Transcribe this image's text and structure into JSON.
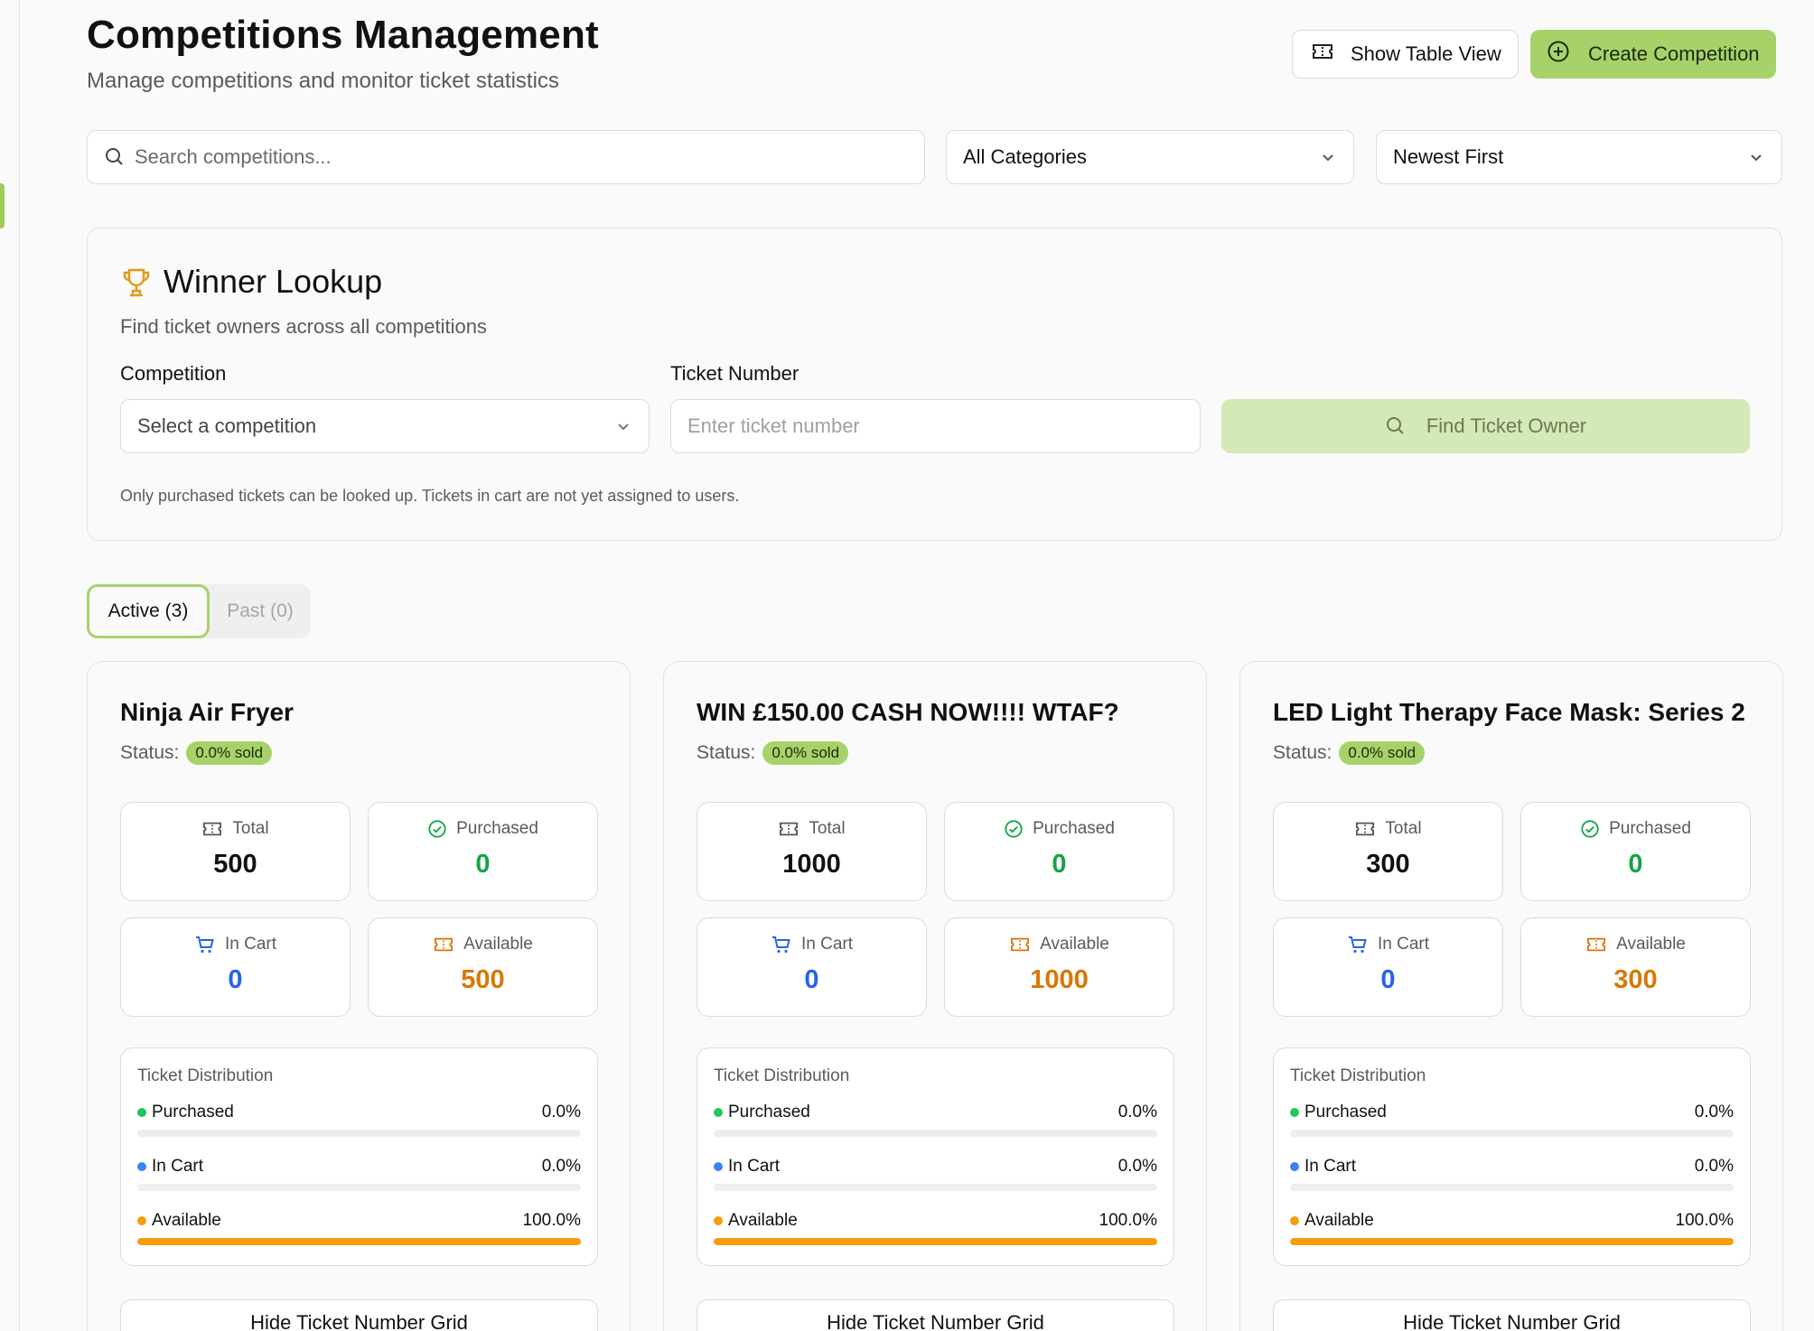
{
  "header": {
    "title": "Competitions Management",
    "subtitle": "Manage competitions and monitor ticket statistics",
    "table_view_label": "Show Table View",
    "create_label": "Create Competition"
  },
  "filters": {
    "search_placeholder": "Search competitions...",
    "category_value": "All Categories",
    "sort_value": "Newest First"
  },
  "winner_lookup": {
    "title": "Winner Lookup",
    "subtitle": "Find ticket owners across all competitions",
    "competition_label": "Competition",
    "competition_placeholder": "Select a competition",
    "ticket_label": "Ticket Number",
    "ticket_placeholder": "Enter ticket number",
    "find_label": "Find Ticket Owner",
    "note": "Only purchased tickets can be looked up. Tickets in cart are not yet assigned to users."
  },
  "tabs": [
    {
      "label": "Active (3)"
    },
    {
      "label": "Past (0)"
    }
  ],
  "labels": {
    "status": "Status:",
    "total": "Total",
    "purchased": "Purchased",
    "in_cart": "In Cart",
    "available": "Available",
    "distribution": "Ticket Distribution",
    "grid_button": "Hide Ticket Number Grid"
  },
  "colors": {
    "accent": "#a7d26a",
    "purchased": "#16a34a",
    "in_cart": "#2563eb",
    "available": "#d97706",
    "bar_available": "#f59e0b"
  },
  "competitions": [
    {
      "title": "Ninja Air Fryer",
      "status_badge": "0.0% sold",
      "total": "500",
      "purchased": "0",
      "in_cart": "0",
      "available": "500",
      "purchased_pct": "0.0%",
      "in_cart_pct": "0.0%",
      "available_pct": "100.0%",
      "purchased_fraction": 0,
      "in_cart_fraction": 0,
      "available_fraction": 1
    },
    {
      "title": "WIN £150.00 CASH NOW!!!! WTAF?",
      "status_badge": "0.0% sold",
      "total": "1000",
      "purchased": "0",
      "in_cart": "0",
      "available": "1000",
      "purchased_pct": "0.0%",
      "in_cart_pct": "0.0%",
      "available_pct": "100.0%",
      "purchased_fraction": 0,
      "in_cart_fraction": 0,
      "available_fraction": 1
    },
    {
      "title": "LED Light Therapy Face Mask: Series 2",
      "status_badge": "0.0% sold",
      "total": "300",
      "purchased": "0",
      "in_cart": "0",
      "available": "300",
      "purchased_pct": "0.0%",
      "in_cart_pct": "0.0%",
      "available_pct": "100.0%",
      "purchased_fraction": 0,
      "in_cart_fraction": 0,
      "available_fraction": 1
    }
  ]
}
